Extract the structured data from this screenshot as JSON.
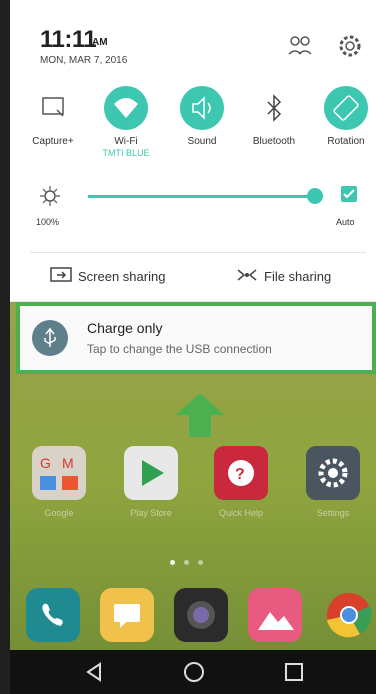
{
  "status": {
    "time": "11:11",
    "ampm": "AM",
    "date": "MON, MAR 7, 2016"
  },
  "header_icons": [
    "account-switch-icon",
    "gear-icon"
  ],
  "quick_tiles": [
    {
      "label": "Capture+",
      "icon": "capture-icon",
      "state": "off"
    },
    {
      "label": "Wi-Fi",
      "sub": "TMTI BLUE",
      "icon": "wifi-icon",
      "state": "on"
    },
    {
      "label": "Sound",
      "icon": "sound-icon",
      "state": "on"
    },
    {
      "label": "Bluetooth",
      "icon": "bluetooth-icon",
      "state": "off"
    },
    {
      "label": "Rotation",
      "icon": "rotation-icon",
      "state": "on"
    }
  ],
  "brightness": {
    "value_label": "100%",
    "level_fraction": 1.0,
    "auto_label": "Auto",
    "auto_checked": true
  },
  "share": {
    "screen_label": "Screen sharing",
    "file_label": "File sharing"
  },
  "notification": {
    "title": "Charge only",
    "text": "Tap to change the USB connection"
  },
  "home_apps": [
    {
      "label": "Google",
      "icon": "google-folder-icon",
      "color": "#d8d2c8"
    },
    {
      "label": "Play Store",
      "icon": "play-store-icon",
      "color": "#e8e8e8"
    },
    {
      "label": "Quick Help",
      "icon": "quick-help-icon",
      "color": "#c9283d"
    },
    {
      "label": "Settings",
      "icon": "settings-icon",
      "color": "#4a5560"
    }
  ],
  "dock_apps": [
    {
      "icon": "phone-icon",
      "color": "#1f8a8f"
    },
    {
      "icon": "messaging-icon",
      "color": "#f0c24b"
    },
    {
      "icon": "camera-icon",
      "color": "#2b2b2b"
    },
    {
      "icon": "gallery-icon",
      "color": "#e85a7f"
    },
    {
      "icon": "chrome-icon",
      "color": "#d8402c"
    }
  ],
  "colors": {
    "accent": "#3ec7b0",
    "highlight": "#4caf50"
  }
}
